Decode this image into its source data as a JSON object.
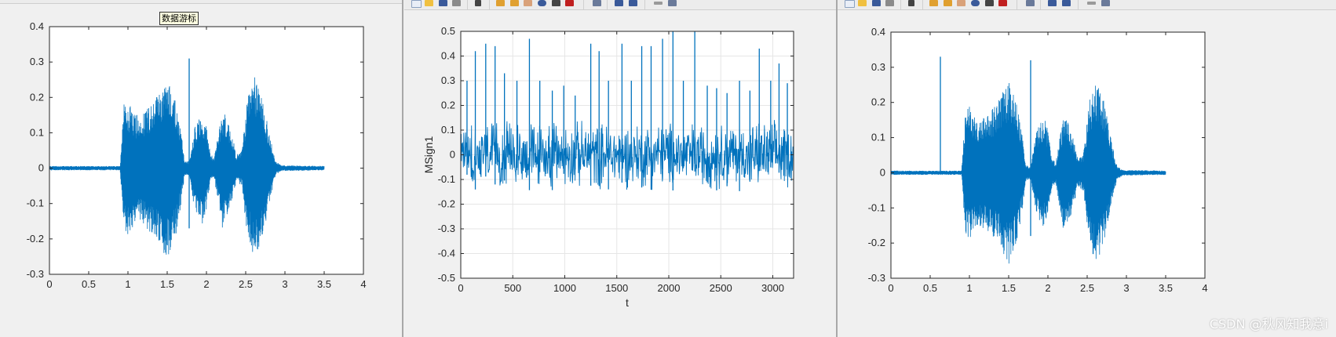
{
  "tooltip": "数据游标",
  "watermark": "CSDN @秋风知我意i",
  "colors": {
    "line": "#0072bd",
    "axes": "#262626",
    "grid": "#e6e6e6"
  },
  "chart_data": [
    {
      "type": "line",
      "series_shape": "speech waveform",
      "xlim": [
        0,
        4
      ],
      "ylim": [
        -0.3,
        0.4
      ],
      "xticks": [
        0,
        0.5,
        1,
        1.5,
        2,
        2.5,
        3,
        3.5,
        4
      ],
      "xtick_labels": [
        "0",
        "0.5",
        "1",
        "1.5",
        "2",
        "2.5",
        "3",
        "3.5",
        "4"
      ],
      "yticks": [
        -0.3,
        -0.2,
        -0.1,
        0,
        0.1,
        0.2,
        0.3,
        0.4
      ],
      "ytick_labels": [
        "-0.3",
        "-0.2",
        "-0.1",
        "0",
        "0.1",
        "0.2",
        "0.3",
        "0.4"
      ],
      "xlabel": "",
      "ylabel": "",
      "grid": false,
      "signal_end": 3.5,
      "envelope": [
        [
          0,
          0.006
        ],
        [
          0.9,
          0.006
        ],
        [
          0.95,
          0.18
        ],
        [
          1.0,
          0.19
        ],
        [
          1.1,
          0.15
        ],
        [
          1.2,
          0.16
        ],
        [
          1.35,
          0.2
        ],
        [
          1.5,
          0.26
        ],
        [
          1.6,
          0.2
        ],
        [
          1.68,
          0.1
        ],
        [
          1.72,
          0.02
        ],
        [
          1.78,
          0.02
        ],
        [
          1.85,
          0.12
        ],
        [
          1.95,
          0.16
        ],
        [
          2.0,
          0.12
        ],
        [
          2.05,
          0.04
        ],
        [
          2.1,
          0.03
        ],
        [
          2.2,
          0.17
        ],
        [
          2.3,
          0.12
        ],
        [
          2.38,
          0.04
        ],
        [
          2.45,
          0.05
        ],
        [
          2.52,
          0.2
        ],
        [
          2.62,
          0.26
        ],
        [
          2.72,
          0.2
        ],
        [
          2.8,
          0.1
        ],
        [
          2.88,
          0.02
        ],
        [
          2.95,
          0.008
        ],
        [
          3.5,
          0.006
        ]
      ],
      "spikes": [
        [
          1.78,
          0.31,
          -0.17
        ]
      ],
      "plot_box": [
        63,
        34,
        463,
        350
      ]
    },
    {
      "type": "line",
      "series_shape": "noise with periodic spikes",
      "xlim": [
        0,
        3200
      ],
      "ylim": [
        -0.5,
        0.5
      ],
      "xticks": [
        0,
        500,
        1000,
        1500,
        2000,
        2500,
        3000
      ],
      "xtick_labels": [
        "0",
        "500",
        "1000",
        "1500",
        "2000",
        "2500",
        "3000"
      ],
      "yticks": [
        -0.5,
        -0.4,
        -0.3,
        -0.2,
        -0.1,
        0,
        0.1,
        0.2,
        0.3,
        0.4,
        0.5
      ],
      "ytick_labels": [
        "-0.5",
        "-0.4",
        "-0.3",
        "-0.2",
        "-0.1",
        "0",
        "0.1",
        "0.2",
        "0.3",
        "0.4",
        "0.5"
      ],
      "xlabel": "t",
      "ylabel": "MSign1",
      "grid": true,
      "signal_end": 3200,
      "noise_amplitude": 0.1,
      "spike_positions": [
        60,
        140,
        240,
        330,
        420,
        540,
        660,
        760,
        880,
        990,
        1100,
        1250,
        1330,
        1420,
        1550,
        1640,
        1740,
        1830,
        1940,
        2040,
        2140,
        2250,
        2370,
        2460,
        2560,
        2680,
        2780,
        2870,
        2980,
        3060,
        3140
      ],
      "spike_heights": [
        0.3,
        0.42,
        0.45,
        0.44,
        0.33,
        0.3,
        0.47,
        0.3,
        0.26,
        0.28,
        0.24,
        0.45,
        0.42,
        0.3,
        0.45,
        0.3,
        0.44,
        0.44,
        0.47,
        0.5,
        0.3,
        0.5,
        0.28,
        0.27,
        0.25,
        0.3,
        0.26,
        0.43,
        0.3,
        0.37,
        0.29
      ],
      "plot_box": [
        587,
        40,
        1011,
        355
      ]
    },
    {
      "type": "line",
      "series_shape": "speech waveform",
      "xlim": [
        0,
        4
      ],
      "ylim": [
        -0.3,
        0.4
      ],
      "xticks": [
        0,
        0.5,
        1,
        1.5,
        2,
        2.5,
        3,
        3.5,
        4
      ],
      "xtick_labels": [
        "0",
        "0.5",
        "1",
        "1.5",
        "2",
        "2.5",
        "3",
        "3.5",
        "4"
      ],
      "yticks": [
        -0.3,
        -0.2,
        -0.1,
        0,
        0.1,
        0.2,
        0.3,
        0.4
      ],
      "ytick_labels": [
        "-0.3",
        "-0.2",
        "-0.1",
        "0",
        "0.1",
        "0.2",
        "0.3",
        "0.4"
      ],
      "xlabel": "",
      "ylabel": "",
      "grid": false,
      "signal_end": 3.5,
      "envelope": [
        [
          0,
          0.006
        ],
        [
          0.9,
          0.006
        ],
        [
          0.95,
          0.18
        ],
        [
          1.0,
          0.19
        ],
        [
          1.1,
          0.15
        ],
        [
          1.2,
          0.16
        ],
        [
          1.35,
          0.2
        ],
        [
          1.5,
          0.26
        ],
        [
          1.6,
          0.2
        ],
        [
          1.68,
          0.1
        ],
        [
          1.72,
          0.02
        ],
        [
          1.78,
          0.02
        ],
        [
          1.85,
          0.12
        ],
        [
          1.95,
          0.16
        ],
        [
          2.0,
          0.12
        ],
        [
          2.05,
          0.04
        ],
        [
          2.1,
          0.03
        ],
        [
          2.2,
          0.17
        ],
        [
          2.3,
          0.12
        ],
        [
          2.38,
          0.04
        ],
        [
          2.45,
          0.05
        ],
        [
          2.52,
          0.2
        ],
        [
          2.62,
          0.26
        ],
        [
          2.72,
          0.2
        ],
        [
          2.8,
          0.1
        ],
        [
          2.88,
          0.02
        ],
        [
          2.95,
          0.008
        ],
        [
          3.5,
          0.006
        ]
      ],
      "spikes": [
        [
          0.63,
          0.33,
          0
        ],
        [
          1.78,
          0.32,
          -0.18
        ]
      ],
      "plot_box": [
        1135,
        41,
        1535,
        355
      ]
    }
  ]
}
